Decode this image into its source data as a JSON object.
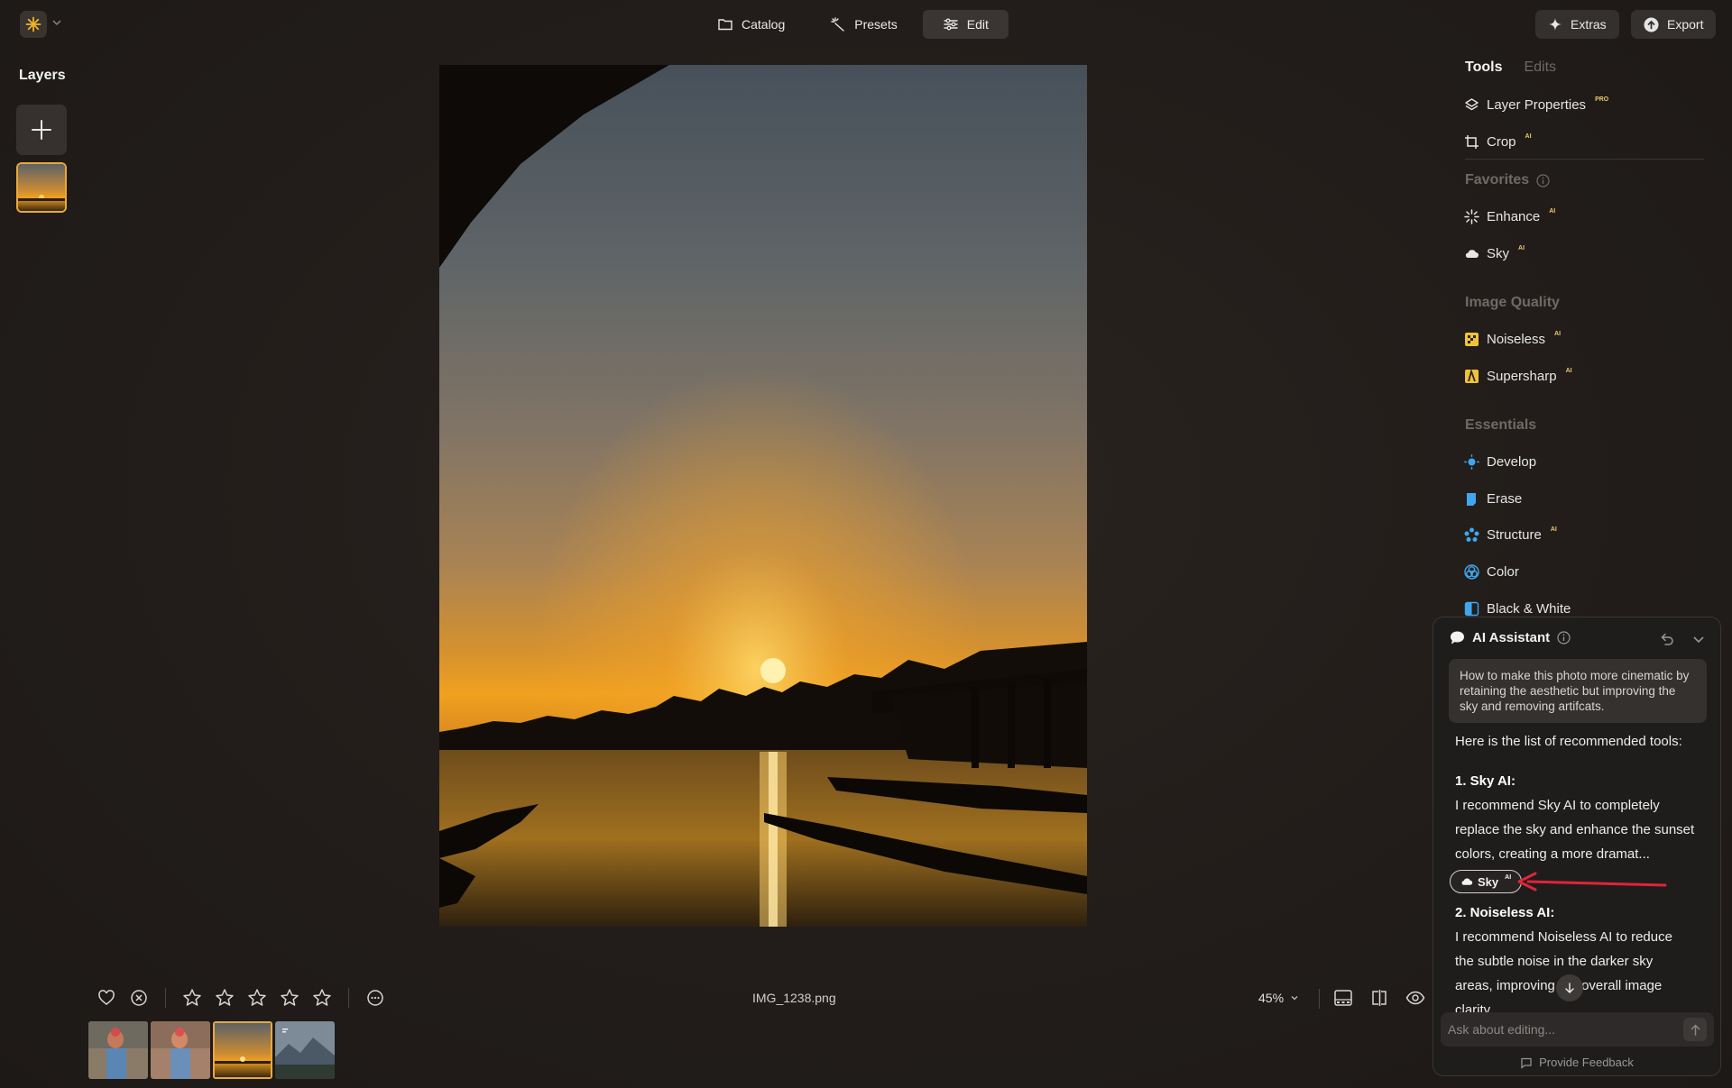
{
  "topbar": {
    "tabs": [
      {
        "label": "Catalog",
        "icon": "folder-icon"
      },
      {
        "label": "Presets",
        "icon": "sparkle-wand-icon"
      },
      {
        "label": "Edit",
        "icon": "sliders-icon",
        "active": true
      }
    ],
    "extras_label": "Extras",
    "export_label": "Export"
  },
  "layers": {
    "title": "Layers"
  },
  "right_panel": {
    "tabs": [
      "Tools",
      "Edits"
    ],
    "top_tools": [
      {
        "label": "Layer Properties",
        "badge": "PRO",
        "icon": "layers-icon"
      },
      {
        "label": "Crop",
        "badge": "AI",
        "icon": "crop-icon"
      }
    ],
    "sections": {
      "favorites": "Favorites",
      "image_quality": "Image Quality",
      "essentials": "Essentials"
    },
    "favorites": [
      {
        "label": "Enhance",
        "badge": "AI"
      },
      {
        "label": "Sky",
        "badge": "AI"
      }
    ],
    "image_quality": [
      {
        "label": "Noiseless",
        "badge": "AI"
      },
      {
        "label": "Supersharp",
        "badge": "AI"
      }
    ],
    "essentials": [
      {
        "label": "Develop",
        "badge": ""
      },
      {
        "label": "Erase",
        "badge": ""
      },
      {
        "label": "Structure",
        "badge": "AI"
      },
      {
        "label": "Color",
        "badge": ""
      },
      {
        "label": "Black & White",
        "badge": ""
      }
    ]
  },
  "ai_assistant": {
    "title": "AI Assistant",
    "prompt": "How to make this photo more cinematic by retaining the aesthetic but improving the sky and removing artifcats.",
    "intro": "Here is the list of recommended tools:",
    "items": [
      {
        "heading": "1. Sky AI:",
        "text": "I recommend Sky AI to completely replace the sky and enhance the sunset colors, creating a more dramat...",
        "chip": "Sky",
        "chip_badge": "AI"
      },
      {
        "heading": "2. Noiseless AI:",
        "text": "I recommend Noiseless AI to reduce the subtle noise in the darker sky areas, improving the overall image clarity."
      }
    ],
    "input_placeholder": "Ask about editing...",
    "feedback_label": "Provide Feedback"
  },
  "bottom": {
    "filename": "IMG_1238.png",
    "zoom": "45%",
    "rating": 0
  },
  "colors": {
    "accent": "#e8a93a",
    "background": "#221d1a",
    "annotation_arrow": "#e0243a"
  }
}
